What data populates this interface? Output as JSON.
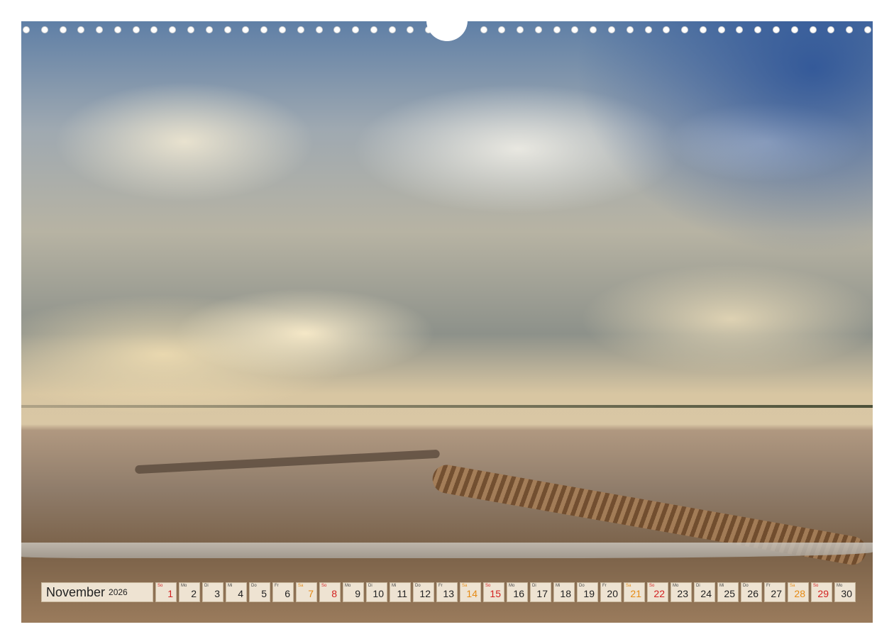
{
  "calendar": {
    "month": "November",
    "year": "2026",
    "days": [
      {
        "wd": "So",
        "num": "1",
        "type": "sun"
      },
      {
        "wd": "Mo",
        "num": "2",
        "type": "week"
      },
      {
        "wd": "Di",
        "num": "3",
        "type": "week"
      },
      {
        "wd": "Mi",
        "num": "4",
        "type": "week"
      },
      {
        "wd": "Do",
        "num": "5",
        "type": "week"
      },
      {
        "wd": "Fr",
        "num": "6",
        "type": "week"
      },
      {
        "wd": "Sa",
        "num": "7",
        "type": "sat"
      },
      {
        "wd": "So",
        "num": "8",
        "type": "sun"
      },
      {
        "wd": "Mo",
        "num": "9",
        "type": "week"
      },
      {
        "wd": "Di",
        "num": "10",
        "type": "week"
      },
      {
        "wd": "Mi",
        "num": "11",
        "type": "week"
      },
      {
        "wd": "Do",
        "num": "12",
        "type": "week"
      },
      {
        "wd": "Fr",
        "num": "13",
        "type": "week"
      },
      {
        "wd": "Sa",
        "num": "14",
        "type": "sat"
      },
      {
        "wd": "So",
        "num": "15",
        "type": "sun"
      },
      {
        "wd": "Mo",
        "num": "16",
        "type": "week"
      },
      {
        "wd": "Di",
        "num": "17",
        "type": "week"
      },
      {
        "wd": "Mi",
        "num": "18",
        "type": "week"
      },
      {
        "wd": "Do",
        "num": "19",
        "type": "week"
      },
      {
        "wd": "Fr",
        "num": "20",
        "type": "week"
      },
      {
        "wd": "Sa",
        "num": "21",
        "type": "sat"
      },
      {
        "wd": "So",
        "num": "22",
        "type": "sun"
      },
      {
        "wd": "Mo",
        "num": "23",
        "type": "week"
      },
      {
        "wd": "Di",
        "num": "24",
        "type": "week"
      },
      {
        "wd": "Mi",
        "num": "25",
        "type": "week"
      },
      {
        "wd": "Do",
        "num": "26",
        "type": "week"
      },
      {
        "wd": "Fr",
        "num": "27",
        "type": "week"
      },
      {
        "wd": "Sa",
        "num": "28",
        "type": "sat"
      },
      {
        "wd": "So",
        "num": "29",
        "type": "sun"
      },
      {
        "wd": "Mo",
        "num": "30",
        "type": "week"
      }
    ]
  },
  "colors": {
    "saturday": "#e58a14",
    "sunday": "#d21f1f",
    "cell_bg": "#f5ecdc"
  },
  "photo": {
    "subject": "mudflat-landscape-photo"
  }
}
